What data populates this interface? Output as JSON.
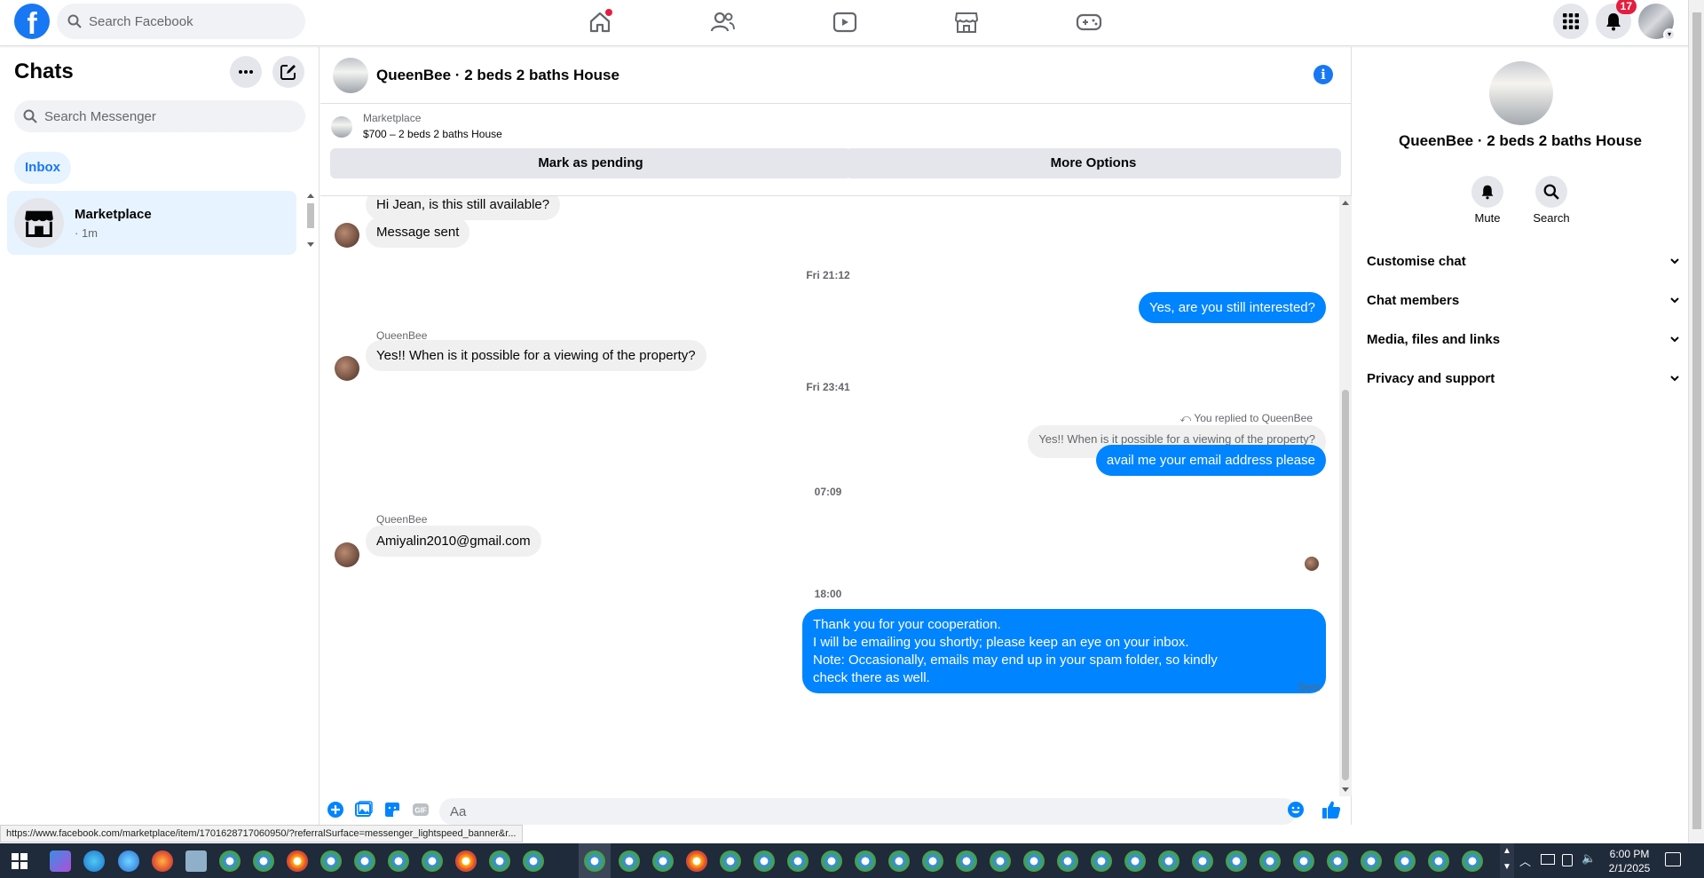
{
  "topbar": {
    "search_placeholder": "Search Facebook",
    "notifications_count": "17"
  },
  "left": {
    "title": "Chats",
    "search_placeholder": "Search Messenger",
    "filter": "Inbox",
    "chat_item": {
      "title": "Marketplace",
      "time": "· 1m"
    }
  },
  "conversation": {
    "title": "QueenBee · 2 beds 2 baths House",
    "marketplace_label": "Marketplace",
    "listing": "$700 – 2 beds 2 baths House",
    "mark_pending": "Mark as pending",
    "more_options": "More Options",
    "messages": {
      "m1": "Hi Jean, is this still available?",
      "m2": "Message sent",
      "ts1": "Fri 21:12",
      "m3": "Yes, are you still interested?",
      "sender1": "QueenBee",
      "m4": "Yes!! When is it possible for a viewing of the property?",
      "ts2": "Fri 23:41",
      "replied": "You replied to QueenBee",
      "quote": "Yes!! When is it possible for a viewing of the property?",
      "m5": "avail me your email address please",
      "ts3": "07:09",
      "sender2": "QueenBee",
      "m6": "Amiyalin2010@gmail.com",
      "ts4": "18:00",
      "m7_l1": "Thank you for your cooperation.",
      "m7_l2": "I will be emailing you shortly; please keep an eye on your inbox.",
      "m7_l3": "Note: Occasionally, emails may end up in your spam folder, so kindly",
      "m7_l4": "check there as well.",
      "sent": "Sent"
    },
    "composer_placeholder": "Aa"
  },
  "right": {
    "title": "QueenBee · 2 beds 2 baths House",
    "mute": "Mute",
    "search": "Search",
    "rows": {
      "r1": "Customise chat",
      "r2": "Chat members",
      "r3": "Media, files and links",
      "r4": "Privacy and support"
    }
  },
  "status_url": "https://www.facebook.com/marketplace/item/1701628717060950/?referralSurface=messenger_lightspeed_banner&r...",
  "taskbar": {
    "time": "6:00 PM",
    "date": "2/1/2025"
  },
  "colors": {
    "brand": "#1877f2",
    "outgoing_bubble": "#0084ff",
    "incoming_bubble": "#f0f0f0",
    "selected_bg": "#e7f3ff",
    "badge": "#e41e3f"
  },
  "icons": {
    "logo": "facebook-logo",
    "nav": [
      "home-icon",
      "friends-icon",
      "video-icon",
      "marketplace-icon",
      "gaming-icon"
    ],
    "top_right": [
      "menu-grid-icon",
      "bell-icon"
    ]
  }
}
